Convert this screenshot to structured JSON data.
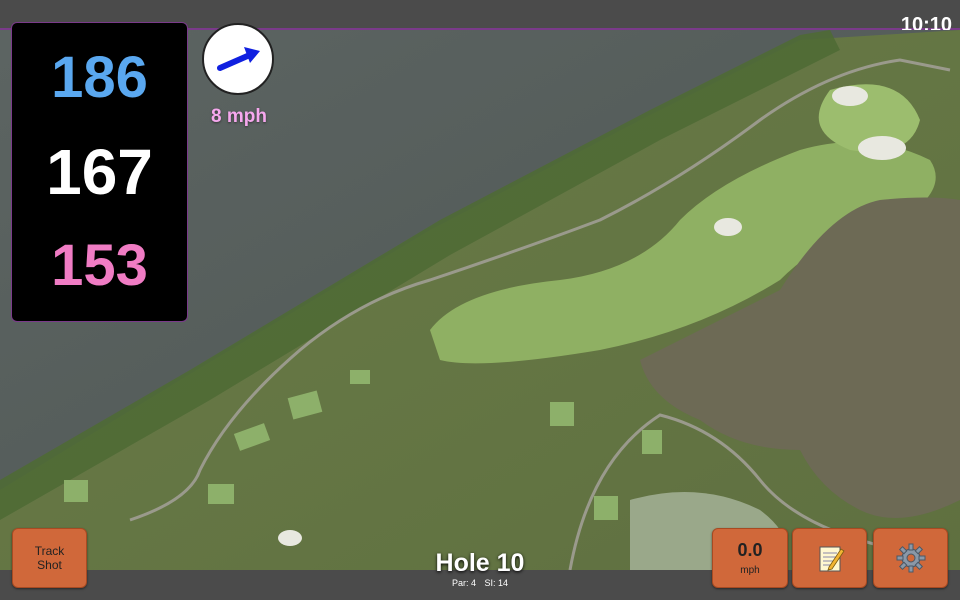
{
  "status_bar": {
    "time": "10:10"
  },
  "distances": {
    "back": "186",
    "middle": "167",
    "front": "153"
  },
  "wind": {
    "speed": "8 mph",
    "icon": "wind-direction-arrow-icon"
  },
  "buttons": {
    "track_shot": [
      "Track",
      "Shot"
    ],
    "speed_value": "0.0",
    "speed_unit": "mph",
    "notes_icon": "notepad-icon",
    "settings_icon": "gear-icon"
  },
  "hole": {
    "title": "Hole 10",
    "par": "Par: 4",
    "si": "SI: 14"
  },
  "colors": {
    "back_distance": "#5aa8f0",
    "middle_distance": "#ffffff",
    "front_distance": "#f07cc4",
    "button": "#d0683a",
    "wind_text": "#f6a8ee"
  }
}
